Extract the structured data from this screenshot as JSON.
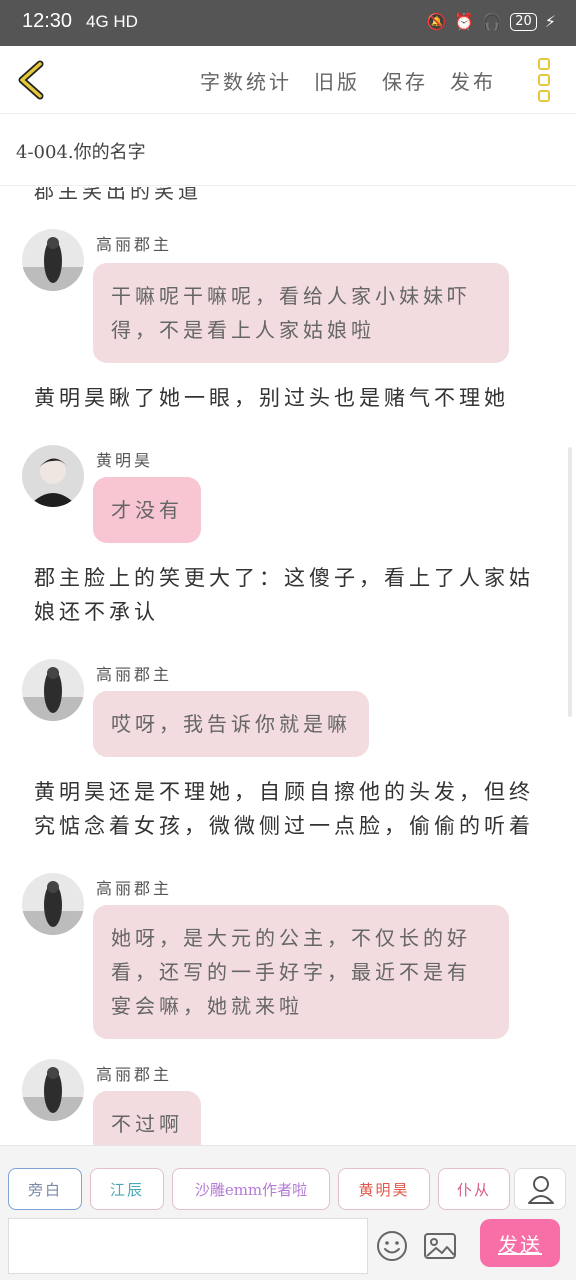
{
  "status_bar": {
    "time": "12:30",
    "network": "4G HD",
    "battery": "20"
  },
  "toolbar": {
    "word_count": "字数统计",
    "old_version": "旧版",
    "save": "保存",
    "publish": "发布"
  },
  "chapter": {
    "title": "4-004.你的名字"
  },
  "content": {
    "clipped_line": "郡主笑出的笑道",
    "messages": [
      {
        "type": "dialogue",
        "speaker": "高丽郡主",
        "text": "干嘛呢干嘛呢，看给人家小妹妹吓得，不是看上人家姑娘啦",
        "style": "light"
      },
      {
        "type": "narration",
        "text": "黄明昊瞅了她一眼，别过头也是赌气不理她"
      },
      {
        "type": "dialogue",
        "speaker": "黄明昊",
        "text": "才没有",
        "style": "pink"
      },
      {
        "type": "narration",
        "text": "郡主脸上的笑更大了：这傻子，看上了人家姑娘还不承认"
      },
      {
        "type": "dialogue",
        "speaker": "高丽郡主",
        "text": "哎呀，我告诉你就是嘛",
        "style": "light"
      },
      {
        "type": "narration",
        "text": "黄明昊还是不理她，自顾自擦他的头发，但终究惦念着女孩，微微侧过一点脸，偷偷的听着"
      },
      {
        "type": "dialogue",
        "speaker": "高丽郡主",
        "text": "她呀，是大元的公主，不仅长的好看，还写的一手好字，最近不是有宴会嘛，她就来啦",
        "style": "light"
      },
      {
        "type": "dialogue",
        "speaker": "高丽郡主",
        "text": "不过啊",
        "style": "light"
      }
    ]
  },
  "roles": [
    {
      "label": "旁白",
      "color": "#7a8aa8"
    },
    {
      "label": "江辰",
      "color": "#4aa9b5"
    },
    {
      "label": "沙雕emm作者啦",
      "color": "#b57ad6"
    },
    {
      "label": "黄明昊",
      "color": "#e0574a"
    },
    {
      "label": "仆从",
      "color": "#d65a8a"
    }
  ],
  "composer": {
    "input_value": "",
    "send_label": "发送"
  },
  "colors": {
    "status_bar": "#555555",
    "bubble_light": "#f2dcdf",
    "bubble_pink": "#f7c6d2",
    "send_button": "#f76fa6",
    "more_icon": "#e6c93a"
  }
}
